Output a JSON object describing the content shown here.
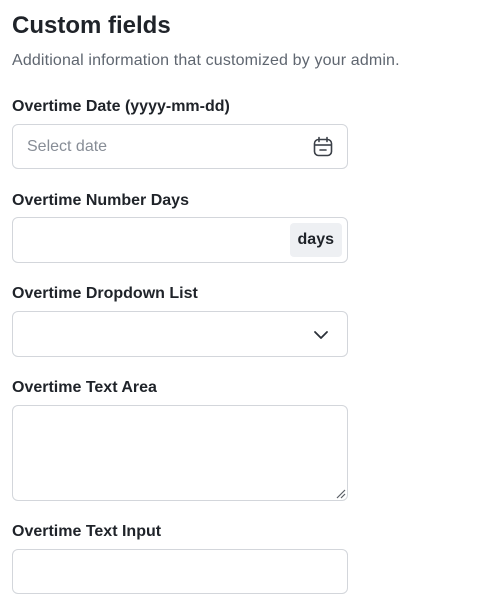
{
  "section": {
    "title": "Custom fields",
    "subtitle": "Additional information that customized by your admin."
  },
  "fields": {
    "date": {
      "label": "Overtime Date (yyyy-mm-dd)",
      "value": "",
      "placeholder": "Select date",
      "icon": "calendar-icon"
    },
    "number_days": {
      "label": "Overtime Number Days",
      "value": "",
      "addon": "days"
    },
    "dropdown": {
      "label": "Overtime Dropdown List",
      "selected": "",
      "icon": "chevron-down-icon"
    },
    "text_area": {
      "label": "Overtime Text Area",
      "value": ""
    },
    "text_input": {
      "label": "Overtime Text Input",
      "value": ""
    }
  },
  "colors": {
    "border": "#d3d6db",
    "text": "#1f2329",
    "muted": "#5f6670",
    "placeholder": "#878d96",
    "addon_bg": "#eef0f3"
  }
}
